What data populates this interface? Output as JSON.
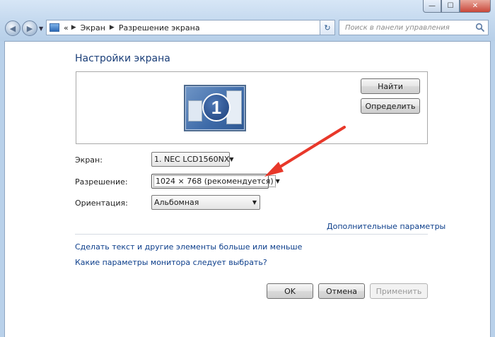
{
  "window": {
    "controls": {
      "minimize": "—",
      "maximize": "☐",
      "close": "✕"
    }
  },
  "nav": {
    "back_icon": "arrow-left-icon",
    "forward_icon": "arrow-right-icon",
    "breadcrumb": [
      "Экран",
      "Разрешение экрана"
    ],
    "breadcrumb_prefix": "«",
    "search_placeholder": "Поиск в панели управления"
  },
  "page": {
    "title": "Настройки экрана",
    "monitor_number": "1",
    "identify_buttons": {
      "find": "Найти",
      "identify": "Определить"
    },
    "fields": {
      "screen": {
        "label": "Экран:",
        "value": "1. NEC LCD1560NX"
      },
      "resolution": {
        "label": "Разрешение:",
        "value": "1024 × 768 (рекомендуется)"
      },
      "orientation": {
        "label": "Ориентация:",
        "value": "Альбомная"
      }
    },
    "advanced_link": "Дополнительные параметры",
    "links": [
      "Сделать текст и другие элементы больше или меньше",
      "Какие параметры монитора следует выбрать?"
    ],
    "buttons": {
      "ok": "OK",
      "cancel": "Отмена",
      "apply": "Применить"
    }
  },
  "annotation": {
    "arrow_color": "#e8382a"
  }
}
